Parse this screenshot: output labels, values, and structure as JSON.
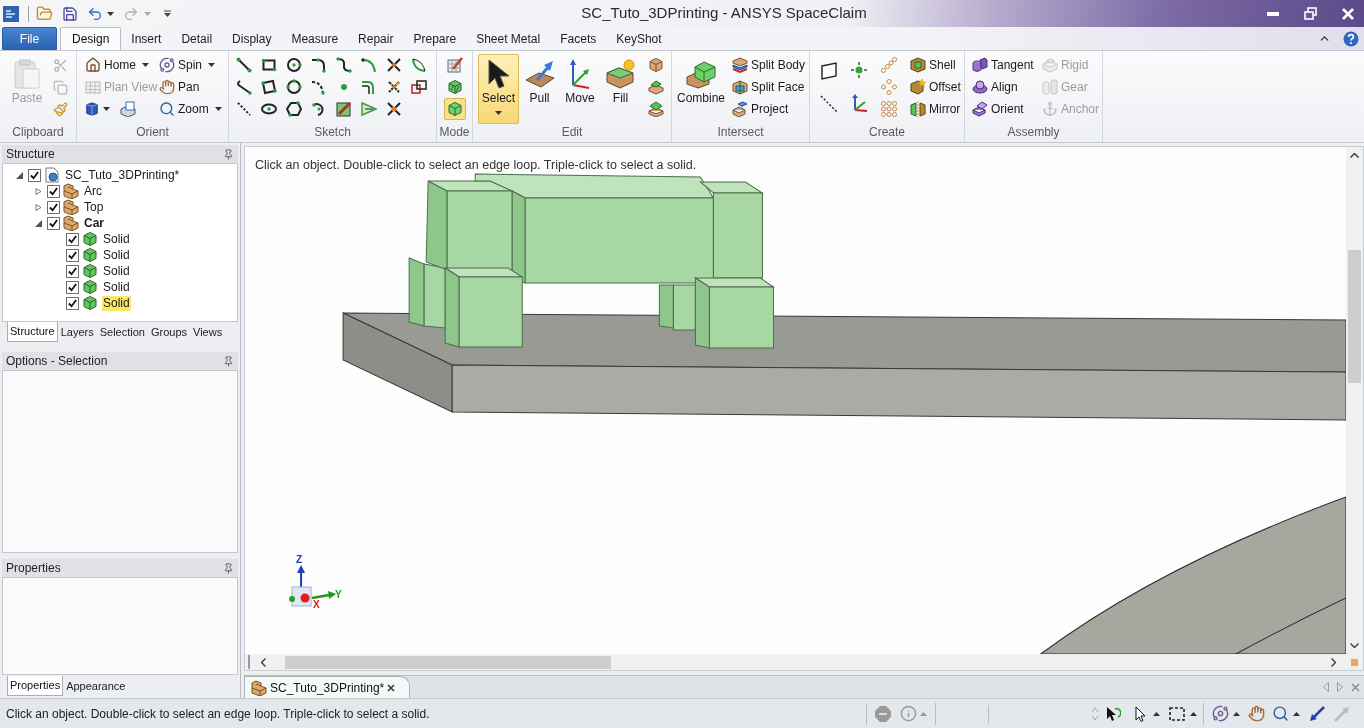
{
  "window": {
    "title": "SC_Tuto_3DPrinting - ANSYS SpaceClaim"
  },
  "ribbon_tabs": [
    {
      "label": "File",
      "kind": "file",
      "selected": false
    },
    {
      "label": "Design",
      "kind": "tab",
      "selected": true
    },
    {
      "label": "Insert",
      "kind": "tab",
      "selected": false
    },
    {
      "label": "Detail",
      "kind": "tab",
      "selected": false
    },
    {
      "label": "Display",
      "kind": "tab",
      "selected": false
    },
    {
      "label": "Measure",
      "kind": "tab",
      "selected": false
    },
    {
      "label": "Repair",
      "kind": "tab",
      "selected": false
    },
    {
      "label": "Prepare",
      "kind": "tab",
      "selected": false
    },
    {
      "label": "Sheet Metal",
      "kind": "tab",
      "selected": false
    },
    {
      "label": "Facets",
      "kind": "tab",
      "selected": false
    },
    {
      "label": "KeyShot",
      "kind": "tab",
      "selected": false
    }
  ],
  "ribbon_groups": [
    {
      "title": "Clipboard",
      "buttons": [
        {
          "label": "Paste",
          "disabled": true
        }
      ]
    },
    {
      "title": "Orient",
      "buttons": [
        {
          "label": "Home",
          "disabled": false,
          "dropdown": true
        },
        {
          "label": "Spin",
          "disabled": false,
          "dropdown": true
        },
        {
          "label": "Plan View",
          "disabled": true,
          "dropdown": false
        },
        {
          "label": "Pan",
          "disabled": false,
          "dropdown": false
        },
        {
          "label": "Zoom",
          "disabled": false,
          "dropdown": true
        }
      ]
    },
    {
      "title": "Sketch"
    },
    {
      "title": "Mode",
      "buttons": [
        {
          "selected": false
        },
        {
          "selected": false
        },
        {
          "selected": true
        }
      ]
    },
    {
      "title": "Edit",
      "buttons": [
        {
          "label": "Select",
          "selected": true,
          "dropdown": true
        },
        {
          "label": "Pull",
          "selected": false,
          "dropdown": false
        },
        {
          "label": "Move",
          "selected": false,
          "dropdown": false
        },
        {
          "label": "Fill",
          "selected": false,
          "dropdown": false
        }
      ]
    },
    {
      "title": "Intersect",
      "buttons": [
        {
          "label": "Combine"
        },
        {
          "label": "Split Body"
        },
        {
          "label": "Split Face"
        },
        {
          "label": "Project"
        }
      ]
    },
    {
      "title": "Create",
      "buttons": [
        {
          "label": "Shell"
        },
        {
          "label": "Offset"
        },
        {
          "label": "Mirror"
        }
      ]
    },
    {
      "title": "Assembly",
      "buttons": [
        {
          "label": "Tangent",
          "disabled": false
        },
        {
          "label": "Rigid",
          "disabled": true
        },
        {
          "label": "Align",
          "disabled": false
        },
        {
          "label": "Gear",
          "disabled": true
        },
        {
          "label": "Orient",
          "disabled": false
        },
        {
          "label": "Anchor",
          "disabled": true
        }
      ]
    }
  ],
  "structure_panel": {
    "title": "Structure",
    "tree": [
      {
        "label": "SC_Tuto_3DPrinting*",
        "kind": "document",
        "checked": true,
        "expanded": true,
        "active": false,
        "selected": false,
        "children": [
          {
            "label": "Arc",
            "kind": "component",
            "checked": true,
            "expanded": false,
            "active": false,
            "selected": false
          },
          {
            "label": "Top",
            "kind": "component",
            "checked": true,
            "expanded": false,
            "active": false,
            "selected": false
          },
          {
            "label": "Car",
            "kind": "component",
            "checked": true,
            "expanded": true,
            "active": true,
            "selected": false,
            "children": [
              {
                "label": "Solid",
                "kind": "body",
                "checked": true,
                "active": false,
                "selected": false
              },
              {
                "label": "Solid",
                "kind": "body",
                "checked": true,
                "active": false,
                "selected": false
              },
              {
                "label": "Solid",
                "kind": "body",
                "checked": true,
                "active": false,
                "selected": false
              },
              {
                "label": "Solid",
                "kind": "body",
                "checked": true,
                "active": false,
                "selected": false
              },
              {
                "label": "Solid",
                "kind": "body",
                "checked": true,
                "active": false,
                "selected": true
              }
            ]
          }
        ]
      }
    ]
  },
  "structure_tabs": [
    {
      "label": "Structure",
      "selected": true
    },
    {
      "label": "Layers",
      "selected": false
    },
    {
      "label": "Selection",
      "selected": false
    },
    {
      "label": "Groups",
      "selected": false
    },
    {
      "label": "Views",
      "selected": false
    }
  ],
  "options_panel": {
    "title": "Options - Selection"
  },
  "properties_panel": {
    "title": "Properties"
  },
  "properties_tabs": [
    {
      "label": "Properties",
      "selected": true
    },
    {
      "label": "Appearance",
      "selected": false
    }
  ],
  "viewport": {
    "hint": "Click an object. Double-click to select an edge loop. Triple-click to select a solid.",
    "axis_labels": [
      "Z",
      "Y",
      "X"
    ]
  },
  "document_tabs": [
    {
      "label": "SC_Tuto_3DPrinting*",
      "selected": true
    }
  ],
  "status_bar": {
    "message": "Click an object. Double-click to select an edge loop. Triple-click to select a solid."
  }
}
